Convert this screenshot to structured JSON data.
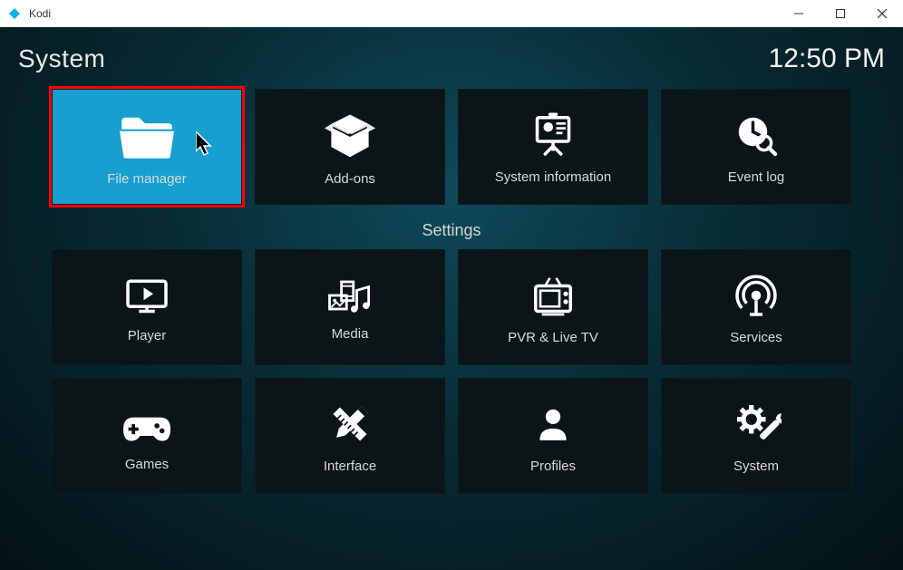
{
  "window": {
    "title": "Kodi"
  },
  "header": {
    "page_title": "System",
    "clock": "12:50 PM"
  },
  "top_tiles": [
    {
      "id": "file-manager",
      "label": "File manager",
      "icon": "folder-icon",
      "selected": true
    },
    {
      "id": "add-ons",
      "label": "Add-ons",
      "icon": "box-open-icon",
      "selected": false
    },
    {
      "id": "system-information",
      "label": "System information",
      "icon": "presentation-icon",
      "selected": false
    },
    {
      "id": "event-log",
      "label": "Event log",
      "icon": "clock-search-icon",
      "selected": false
    }
  ],
  "settings_label": "Settings",
  "settings_tiles": [
    {
      "id": "player",
      "label": "Player",
      "icon": "monitor-play-icon"
    },
    {
      "id": "media",
      "label": "Media",
      "icon": "media-mixed-icon"
    },
    {
      "id": "pvr-live-tv",
      "label": "PVR & Live TV",
      "icon": "tv-icon"
    },
    {
      "id": "services",
      "label": "Services",
      "icon": "broadcast-icon"
    },
    {
      "id": "games",
      "label": "Games",
      "icon": "gamepad-icon"
    },
    {
      "id": "interface",
      "label": "Interface",
      "icon": "pencil-ruler-icon"
    },
    {
      "id": "profiles",
      "label": "Profiles",
      "icon": "user-icon"
    },
    {
      "id": "system",
      "label": "System",
      "icon": "gear-wrench-icon"
    }
  ]
}
